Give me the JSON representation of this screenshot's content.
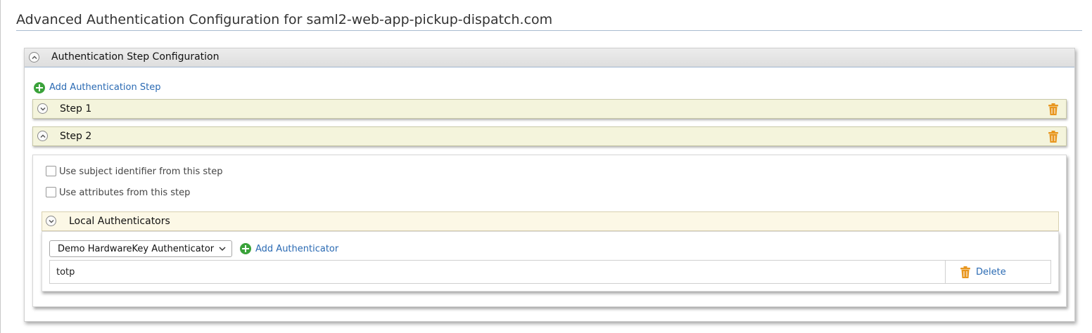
{
  "page": {
    "title": "Advanced Authentication Configuration for saml2-web-app-pickup-dispatch.com"
  },
  "panel": {
    "header": "Authentication Step Configuration",
    "add_step_label": "Add Authentication Step"
  },
  "steps": [
    {
      "label": "Step 1",
      "expanded": false
    },
    {
      "label": "Step 2",
      "expanded": true
    }
  ],
  "step2": {
    "subject_checkbox_label": "Use subject identifier from this step",
    "subject_checked": false,
    "attributes_checkbox_label": "Use attributes from this step",
    "attributes_checked": false,
    "local_authenticators": {
      "header": "Local Authenticators",
      "selected_authenticator": "Demo HardwareKey Authenticator",
      "add_label": "Add Authenticator",
      "rows": [
        {
          "name": "totp",
          "delete_label": "Delete"
        }
      ]
    }
  },
  "icons": {
    "collapse": "chevron-up-icon",
    "expand": "chevron-down-icon",
    "add": "plus-circle-icon",
    "delete": "trash-icon"
  },
  "colors": {
    "link": "#2a6ab3",
    "add_icon": "#3aa23a",
    "trash": "#e8961e",
    "step_bar": "#f4f4dc"
  }
}
